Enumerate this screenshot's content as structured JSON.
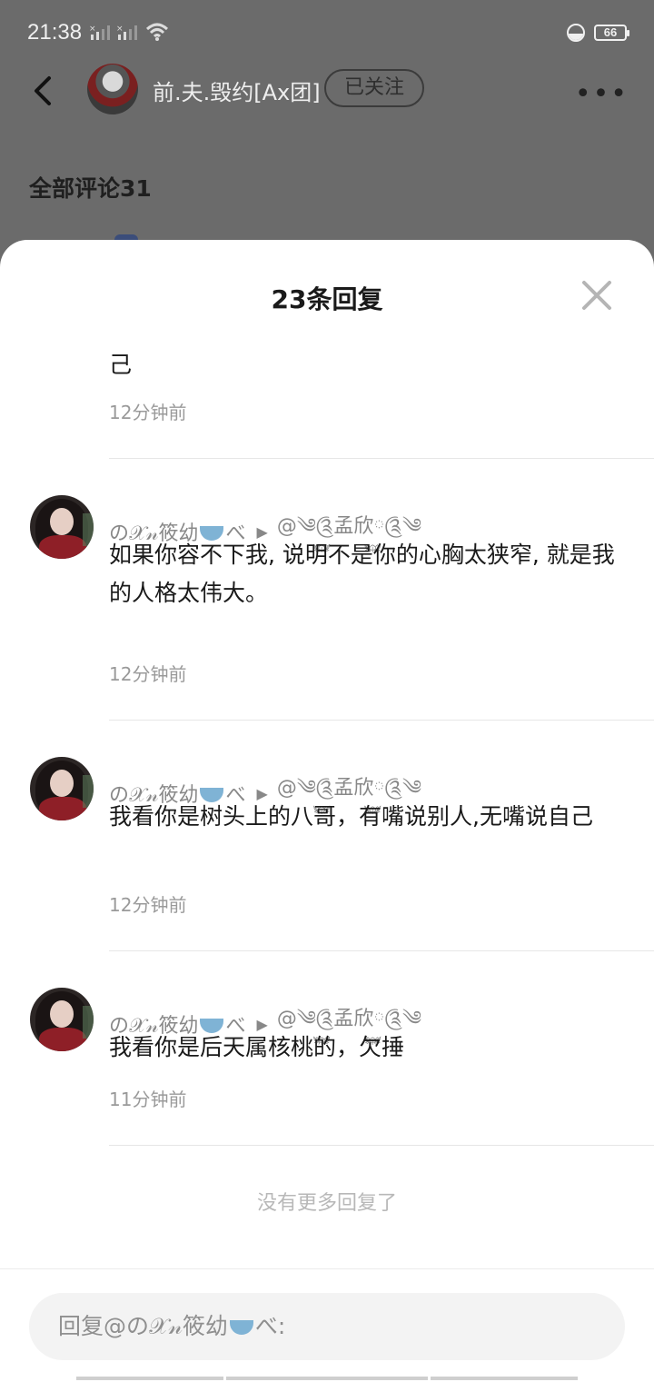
{
  "status_bar": {
    "time": "21:38",
    "battery": "66"
  },
  "header": {
    "author_name": "前.夫.毁约[Ax团]",
    "follow_label": "已关注",
    "more_label": "•••"
  },
  "background": {
    "all_comments_label": "全部评论31"
  },
  "sheet": {
    "title": "23条回复",
    "continued_text": "己",
    "continued_time": "12分钟前",
    "replies": [
      {
        "author": "の𝒳𝓃筱幼",
        "author_suffix": "べ",
        "reply_to": "@༄༊࿆孟欣࿆༊༄",
        "text": "如果你容不下我, 说明不是你的心胸太狭窄, 就是我的人格太伟大。",
        "time": "12分钟前"
      },
      {
        "author": "の𝒳𝓃筱幼",
        "author_suffix": "べ",
        "reply_to": "@༄༊࿆孟欣࿆༊༄",
        "text": "我看你是树头上的八哥，有嘴说别人,无嘴说自己",
        "time": "12分钟前"
      },
      {
        "author": "の𝒳𝓃筱幼",
        "author_suffix": "べ",
        "reply_to": "@༄༊࿆孟欣࿆༊༄",
        "text": "我看你是后天属核桃的，欠捶",
        "time": "11分钟前"
      }
    ],
    "no_more_label": "没有更多回复了",
    "reply_placeholder_prefix": "回复@の𝒳𝓃筱幼",
    "reply_placeholder_suffix": "べ:"
  }
}
